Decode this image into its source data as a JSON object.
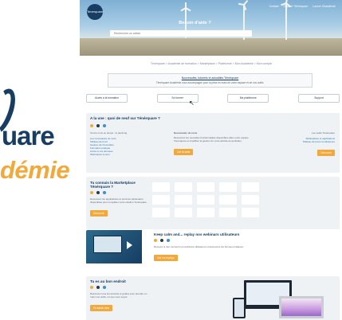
{
  "brand": {
    "side_logo_line1": "uare",
    "side_logo_line2": "démie",
    "hero_logo_text": "Tenerquare",
    "primary": "#173d63",
    "accent": "#f2a93b"
  },
  "hero": {
    "nav": [
      "Contact",
      "Espace Ténérquare",
      "Lancer l'Académie"
    ],
    "title": "Besoin d'aide ?",
    "search_placeholder": "Rechercher un article"
  },
  "breadcrumb": "Ténérquare > Académie de formation > Marketplace > Plateforme > Mon Académie > Mon compte",
  "notice": {
    "line1": "Nouveautés, tutoriels et actualités Ténérquare",
    "line2": "Ténérquare Académie vous accompagne pour la prise en main de votre espace et de vos outils."
  },
  "buttons": [
    "Accès à la formation",
    "Se former",
    "Ma plateforme",
    "Support"
  ],
  "card_intro": {
    "title": "A la une : quoi de neuf sur Ténérquare ?",
    "left_title": "Tout le mois en temps : le planning",
    "left_links": [
      "Les nouveautés du mois",
      "Tableau de bord",
      "Gestion de l'Inventaire",
      "Formation pratique",
      "Accès à vos données",
      "Webinaires à venir"
    ],
    "mid_title": "Nouveautés du mois",
    "mid_text": "Découvrez les nouvelles fonctionnalités disponibles dans votre espace Ténérquare et simplifiez la gestion de votre activité au quotidien.",
    "mid_button": "Lire la suite",
    "right_title": "Les outils Ténérquare",
    "right_links": [
      "Marketplace et applications",
      "Tableau de bord et indicateurs"
    ],
    "right_button": "Découvrir"
  },
  "card_marketplace": {
    "title": "Tu connais la Marketplace Ténérquare ?",
    "text": "Découvrez les applications et services partenaires disponibles pour compléter votre solution Ténérquare.",
    "button": "Découvrir"
  },
  "card_webinar": {
    "title": "Keep calm and... replay nos webinars utilisateurs",
    "text": "Revoyez à tout moment nos webinars utilisateurs et découvrez les bonnes pratiques.",
    "button": "Voir les replays"
  },
  "card_tools": {
    "title": "Tu es au bon endroit",
    "text": "Retrouvez tous les tutoriels et guides pour prendre en main vos outils, où que vous soyez.",
    "button": "En savoir plus"
  },
  "dot_colors": [
    "#f2a93b",
    "#2b3a4a",
    "#3e8dd1"
  ]
}
